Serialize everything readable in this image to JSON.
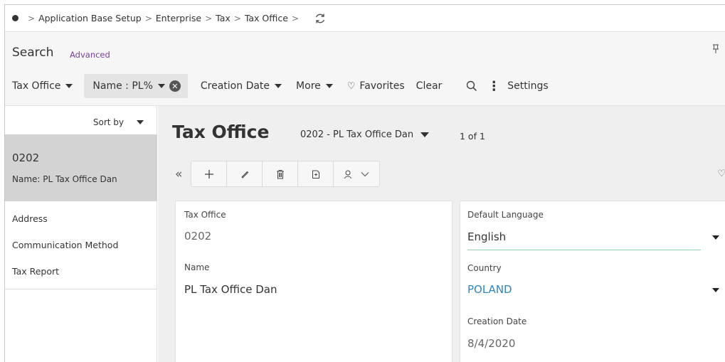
{
  "breadcrumb": {
    "items": [
      "Application Base Setup",
      "Enterprise",
      "Tax",
      "Tax Office"
    ]
  },
  "search": {
    "title": "Search",
    "advanced_link": "Advanced",
    "filters": {
      "tax_office": "Tax Office",
      "name_pill": "Name : PL%",
      "creation_date": "Creation Date",
      "more": "More",
      "favorites": "Favorites",
      "clear": "Clear",
      "settings": "Settings"
    }
  },
  "left_nav": {
    "sort_by": "Sort by",
    "selected_record": {
      "code": "0202",
      "name": "Name:  PL Tax Office Dan"
    },
    "links": [
      "Address",
      "Communication Method",
      "Tax Report"
    ]
  },
  "main": {
    "title": "Tax Office",
    "record_selector": "0202 - PL Tax Office Dan",
    "record_count": "1 of 1",
    "fields": {
      "tax_office": {
        "label": "Tax Office",
        "value": "0202"
      },
      "name": {
        "label": "Name",
        "value": "PL Tax Office Dan"
      },
      "default_language": {
        "label": "Default Language",
        "value": "English"
      },
      "country": {
        "label": "Country",
        "value": "POLAND"
      },
      "creation_date": {
        "label": "Creation Date",
        "value": "8/4/2020"
      }
    }
  },
  "colors": {
    "advanced_link": "#7a3e9d",
    "country_link": "#2e86c1",
    "selected_bg": "#d3d3d3",
    "underline_accent": "#8fd3b0"
  }
}
